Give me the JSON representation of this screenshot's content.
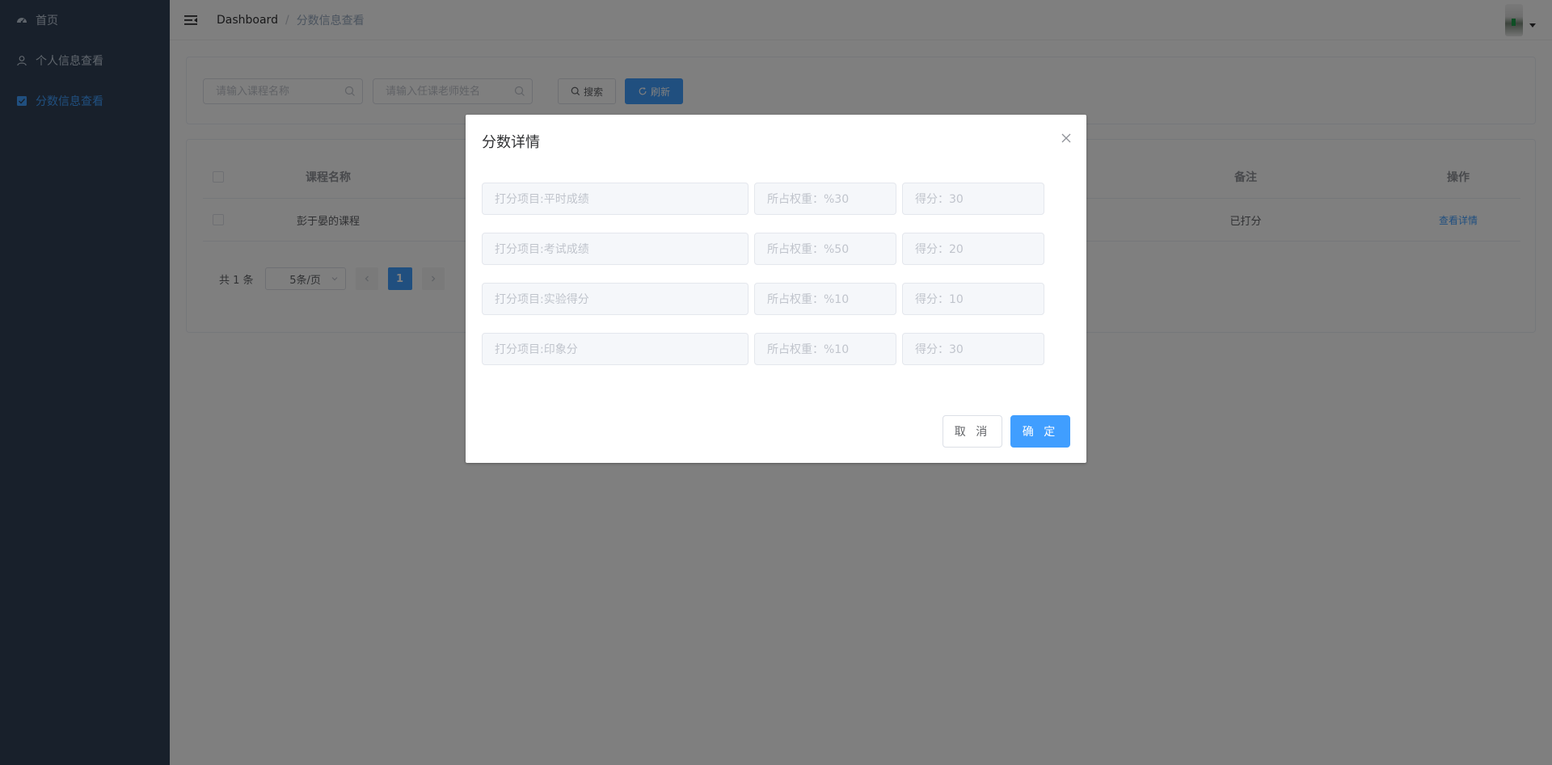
{
  "sidebar": {
    "items": [
      {
        "label": "首页",
        "icon": "dashboard-icon"
      },
      {
        "label": "个人信息查看",
        "icon": "user-icon"
      },
      {
        "label": "分数信息查看",
        "icon": "checkbox-icon",
        "active": true
      }
    ]
  },
  "navbar": {
    "breadcrumb": [
      "Dashboard",
      "分数信息查看"
    ],
    "separator": "/"
  },
  "search": {
    "course_placeholder": "请输入课程名称",
    "teacher_placeholder": "请输入任课老师姓名",
    "search_label": "搜索",
    "refresh_label": "刷新"
  },
  "table": {
    "headers": {
      "name": "课程名称",
      "remark": "备注",
      "operation": "操作"
    },
    "rows": [
      {
        "name": "彭于晏的课程",
        "remark": "已打分",
        "operation": "查看详情"
      }
    ]
  },
  "pagination": {
    "total": "共 1 条",
    "page_size": "5条/页",
    "current_page": "1"
  },
  "dialog": {
    "title": "分数详情",
    "rows": [
      {
        "item": "打分项目:平时成绩",
        "weight": "所占权重：%30",
        "score": "得分：30"
      },
      {
        "item": "打分项目:考试成绩",
        "weight": "所占权重：%50",
        "score": "得分：20"
      },
      {
        "item": "打分项目:实验得分",
        "weight": "所占权重：%10",
        "score": "得分：10"
      },
      {
        "item": "打分项目:印象分",
        "weight": "所占权重：%10",
        "score": "得分：30"
      }
    ],
    "cancel_label": "取 消",
    "ok_label": "确 定"
  },
  "colors": {
    "sidebar_bg": "#304156",
    "accent": "#409eff",
    "overlay": "rgba(0,0,0,0.5)"
  }
}
